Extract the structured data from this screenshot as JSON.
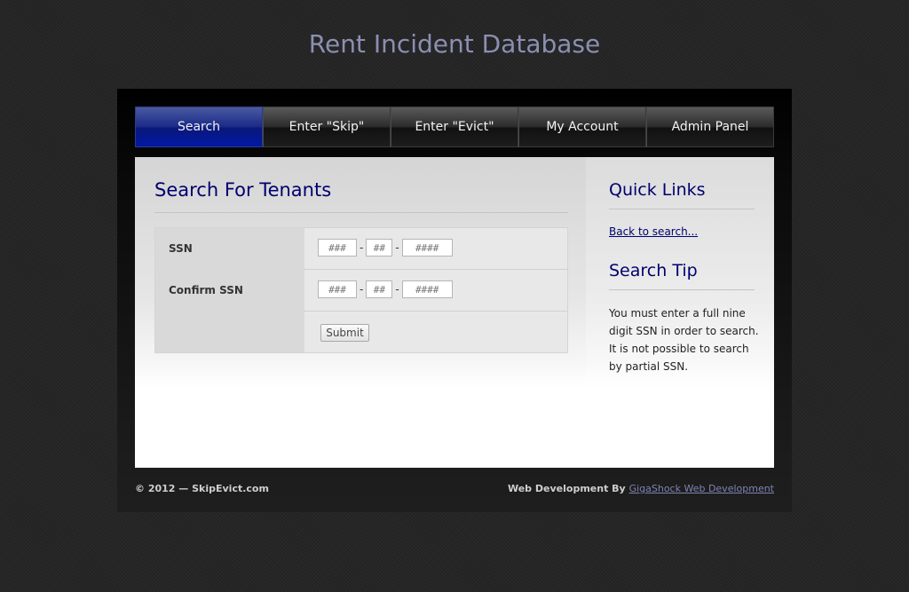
{
  "site": {
    "title": "Rent Incident Database"
  },
  "nav": {
    "items": [
      {
        "label": "Search",
        "active": true
      },
      {
        "label": "Enter \"Skip\"",
        "active": false
      },
      {
        "label": "Enter \"Evict\"",
        "active": false
      },
      {
        "label": "My Account",
        "active": false
      },
      {
        "label": "Admin Panel",
        "active": false
      }
    ]
  },
  "main": {
    "heading": "Search For Tenants",
    "form": {
      "ssn_label": "SSN",
      "confirm_ssn_label": "Confirm SSN",
      "placeholders": {
        "part1": "###",
        "part2": "##",
        "part3": "####"
      },
      "values": {
        "ssn_part1": "",
        "ssn_part2": "",
        "ssn_part3": "",
        "confirm_part1": "",
        "confirm_part2": "",
        "confirm_part3": ""
      },
      "dash": "-",
      "submit_label": "Submit"
    }
  },
  "sidebar": {
    "quick_links_heading": "Quick Links",
    "back_link": "Back to search...",
    "tip_heading": "Search Tip",
    "tip_text": "You must enter a full nine digit SSN in order to search. It is not possible to search by partial SSN."
  },
  "footer": {
    "copyright": "© 2012 — SkipEvict.com",
    "credit_prefix": "Web Development By",
    "credit_link": "GigaShock Web Development"
  },
  "colors": {
    "accent": "#00006e",
    "nav_active": "#0018aa",
    "title": "#8b8fb2",
    "footer_link": "#7f83b5"
  }
}
